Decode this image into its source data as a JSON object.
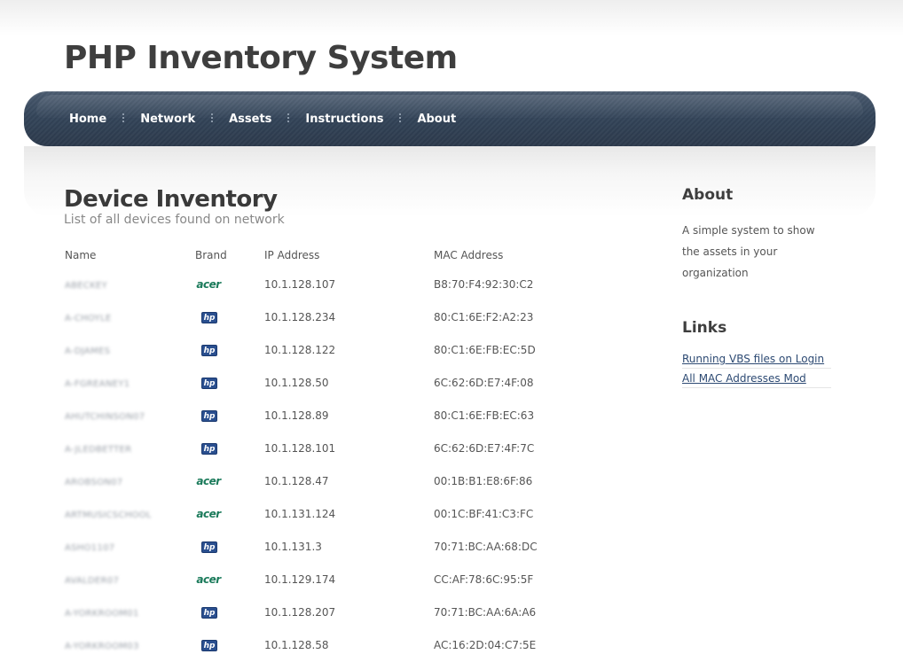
{
  "site": {
    "title": "PHP Inventory System"
  },
  "nav": [
    {
      "label": "Home"
    },
    {
      "label": "Network"
    },
    {
      "label": "Assets"
    },
    {
      "label": "Instructions"
    },
    {
      "label": "About"
    }
  ],
  "main": {
    "title": "Device Inventory",
    "subtitle": "List of all devices found on network",
    "columns": [
      "Name",
      "Brand",
      "IP Address",
      "MAC Address"
    ],
    "rows": [
      {
        "name": "ABECKEY",
        "brand": "acer",
        "ip": "10.1.128.107",
        "mac": "B8:70:F4:92:30:C2"
      },
      {
        "name": "A-CHOYLE",
        "brand": "hp",
        "ip": "10.1.128.234",
        "mac": "80:C1:6E:F2:A2:23"
      },
      {
        "name": "A-DJAMES",
        "brand": "hp",
        "ip": "10.1.128.122",
        "mac": "80:C1:6E:FB:EC:5D"
      },
      {
        "name": "A-FGREANEY1",
        "brand": "hp",
        "ip": "10.1.128.50",
        "mac": "6C:62:6D:E7:4F:08"
      },
      {
        "name": "AHUTCHINSON07",
        "brand": "hp",
        "ip": "10.1.128.89",
        "mac": "80:C1:6E:FB:EC:63"
      },
      {
        "name": "A-JLEDBETTER",
        "brand": "hp",
        "ip": "10.1.128.101",
        "mac": "6C:62:6D:E7:4F:7C"
      },
      {
        "name": "AROBSON07",
        "brand": "acer",
        "ip": "10.1.128.47",
        "mac": "00:1B:B1:E8:6F:86"
      },
      {
        "name": "ARTMUSICSCHOOL",
        "brand": "acer",
        "ip": "10.1.131.124",
        "mac": "00:1C:BF:41:C3:FC"
      },
      {
        "name": "ASHO1107",
        "brand": "hp",
        "ip": "10.1.131.3",
        "mac": "70:71:BC:AA:68:DC"
      },
      {
        "name": "AVALDER07",
        "brand": "acer",
        "ip": "10.1.129.174",
        "mac": "CC:AF:78:6C:95:5F"
      },
      {
        "name": "A-YORKROOM01",
        "brand": "hp",
        "ip": "10.1.128.207",
        "mac": "70:71:BC:AA:6A:A6"
      },
      {
        "name": "A-YORKROOM03",
        "brand": "hp",
        "ip": "10.1.128.58",
        "mac": "AC:16:2D:04:C7:5E"
      }
    ]
  },
  "sidebar": {
    "about_heading": "About",
    "about_text": "A simple system to show the assets in your organization",
    "links_heading": "Links",
    "links": [
      {
        "label": "Running VBS files on Login"
      },
      {
        "label": "All MAC Addresses Mod"
      }
    ]
  },
  "colors": {
    "nav_background": "#34455a",
    "link": "#2d4a73",
    "acer_logo": "#1a7a5a",
    "hp_logo": "#2a4f8f"
  }
}
